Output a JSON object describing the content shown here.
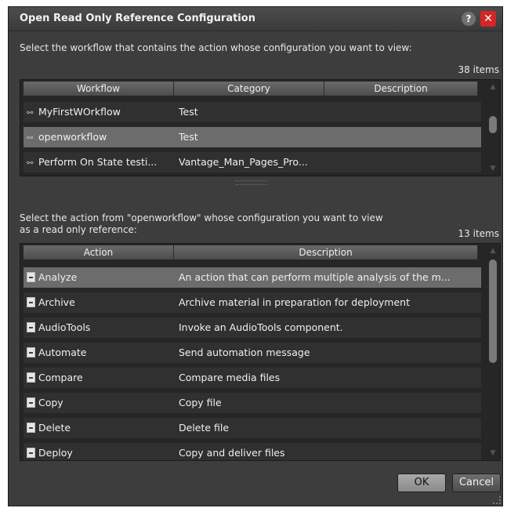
{
  "dialog": {
    "title": "Open Read Only Reference Configuration",
    "help_label": "?",
    "close_label": "✕"
  },
  "workflow_section": {
    "prompt": "Select the workflow that contains the action whose configuration you want to view:",
    "count": "38 items",
    "columns": [
      "Workflow",
      "Category",
      "Description"
    ],
    "rows": [
      {
        "name": "MyFirstWOrkflow",
        "category": "Test",
        "description": ""
      },
      {
        "name": "openworkflow",
        "category": "Test",
        "description": ""
      },
      {
        "name": "Perform On State testi...",
        "category": "Vantage_Man_Pages_Pro...",
        "description": ""
      }
    ],
    "selected_index": 1
  },
  "action_section": {
    "prompt_line1": "Select the action from \"openworkflow\" whose configuration you want to view",
    "prompt_line2": "as a read only reference:",
    "count": "13 items",
    "columns": [
      "Action",
      "Description"
    ],
    "rows": [
      {
        "name": "Analyze",
        "description": "An action that can perform multiple analysis of the m..."
      },
      {
        "name": "Archive",
        "description": "Archive material in preparation for deployment"
      },
      {
        "name": "AudioTools",
        "description": "Invoke an AudioTools component."
      },
      {
        "name": "Automate",
        "description": "Send automation message"
      },
      {
        "name": "Compare",
        "description": "Compare media files"
      },
      {
        "name": "Copy",
        "description": "Copy file"
      },
      {
        "name": "Delete",
        "description": "Delete file"
      },
      {
        "name": "Deploy",
        "description": "Copy and deliver files"
      }
    ],
    "selected_index": 0
  },
  "buttons": {
    "ok": "OK",
    "cancel": "Cancel"
  }
}
